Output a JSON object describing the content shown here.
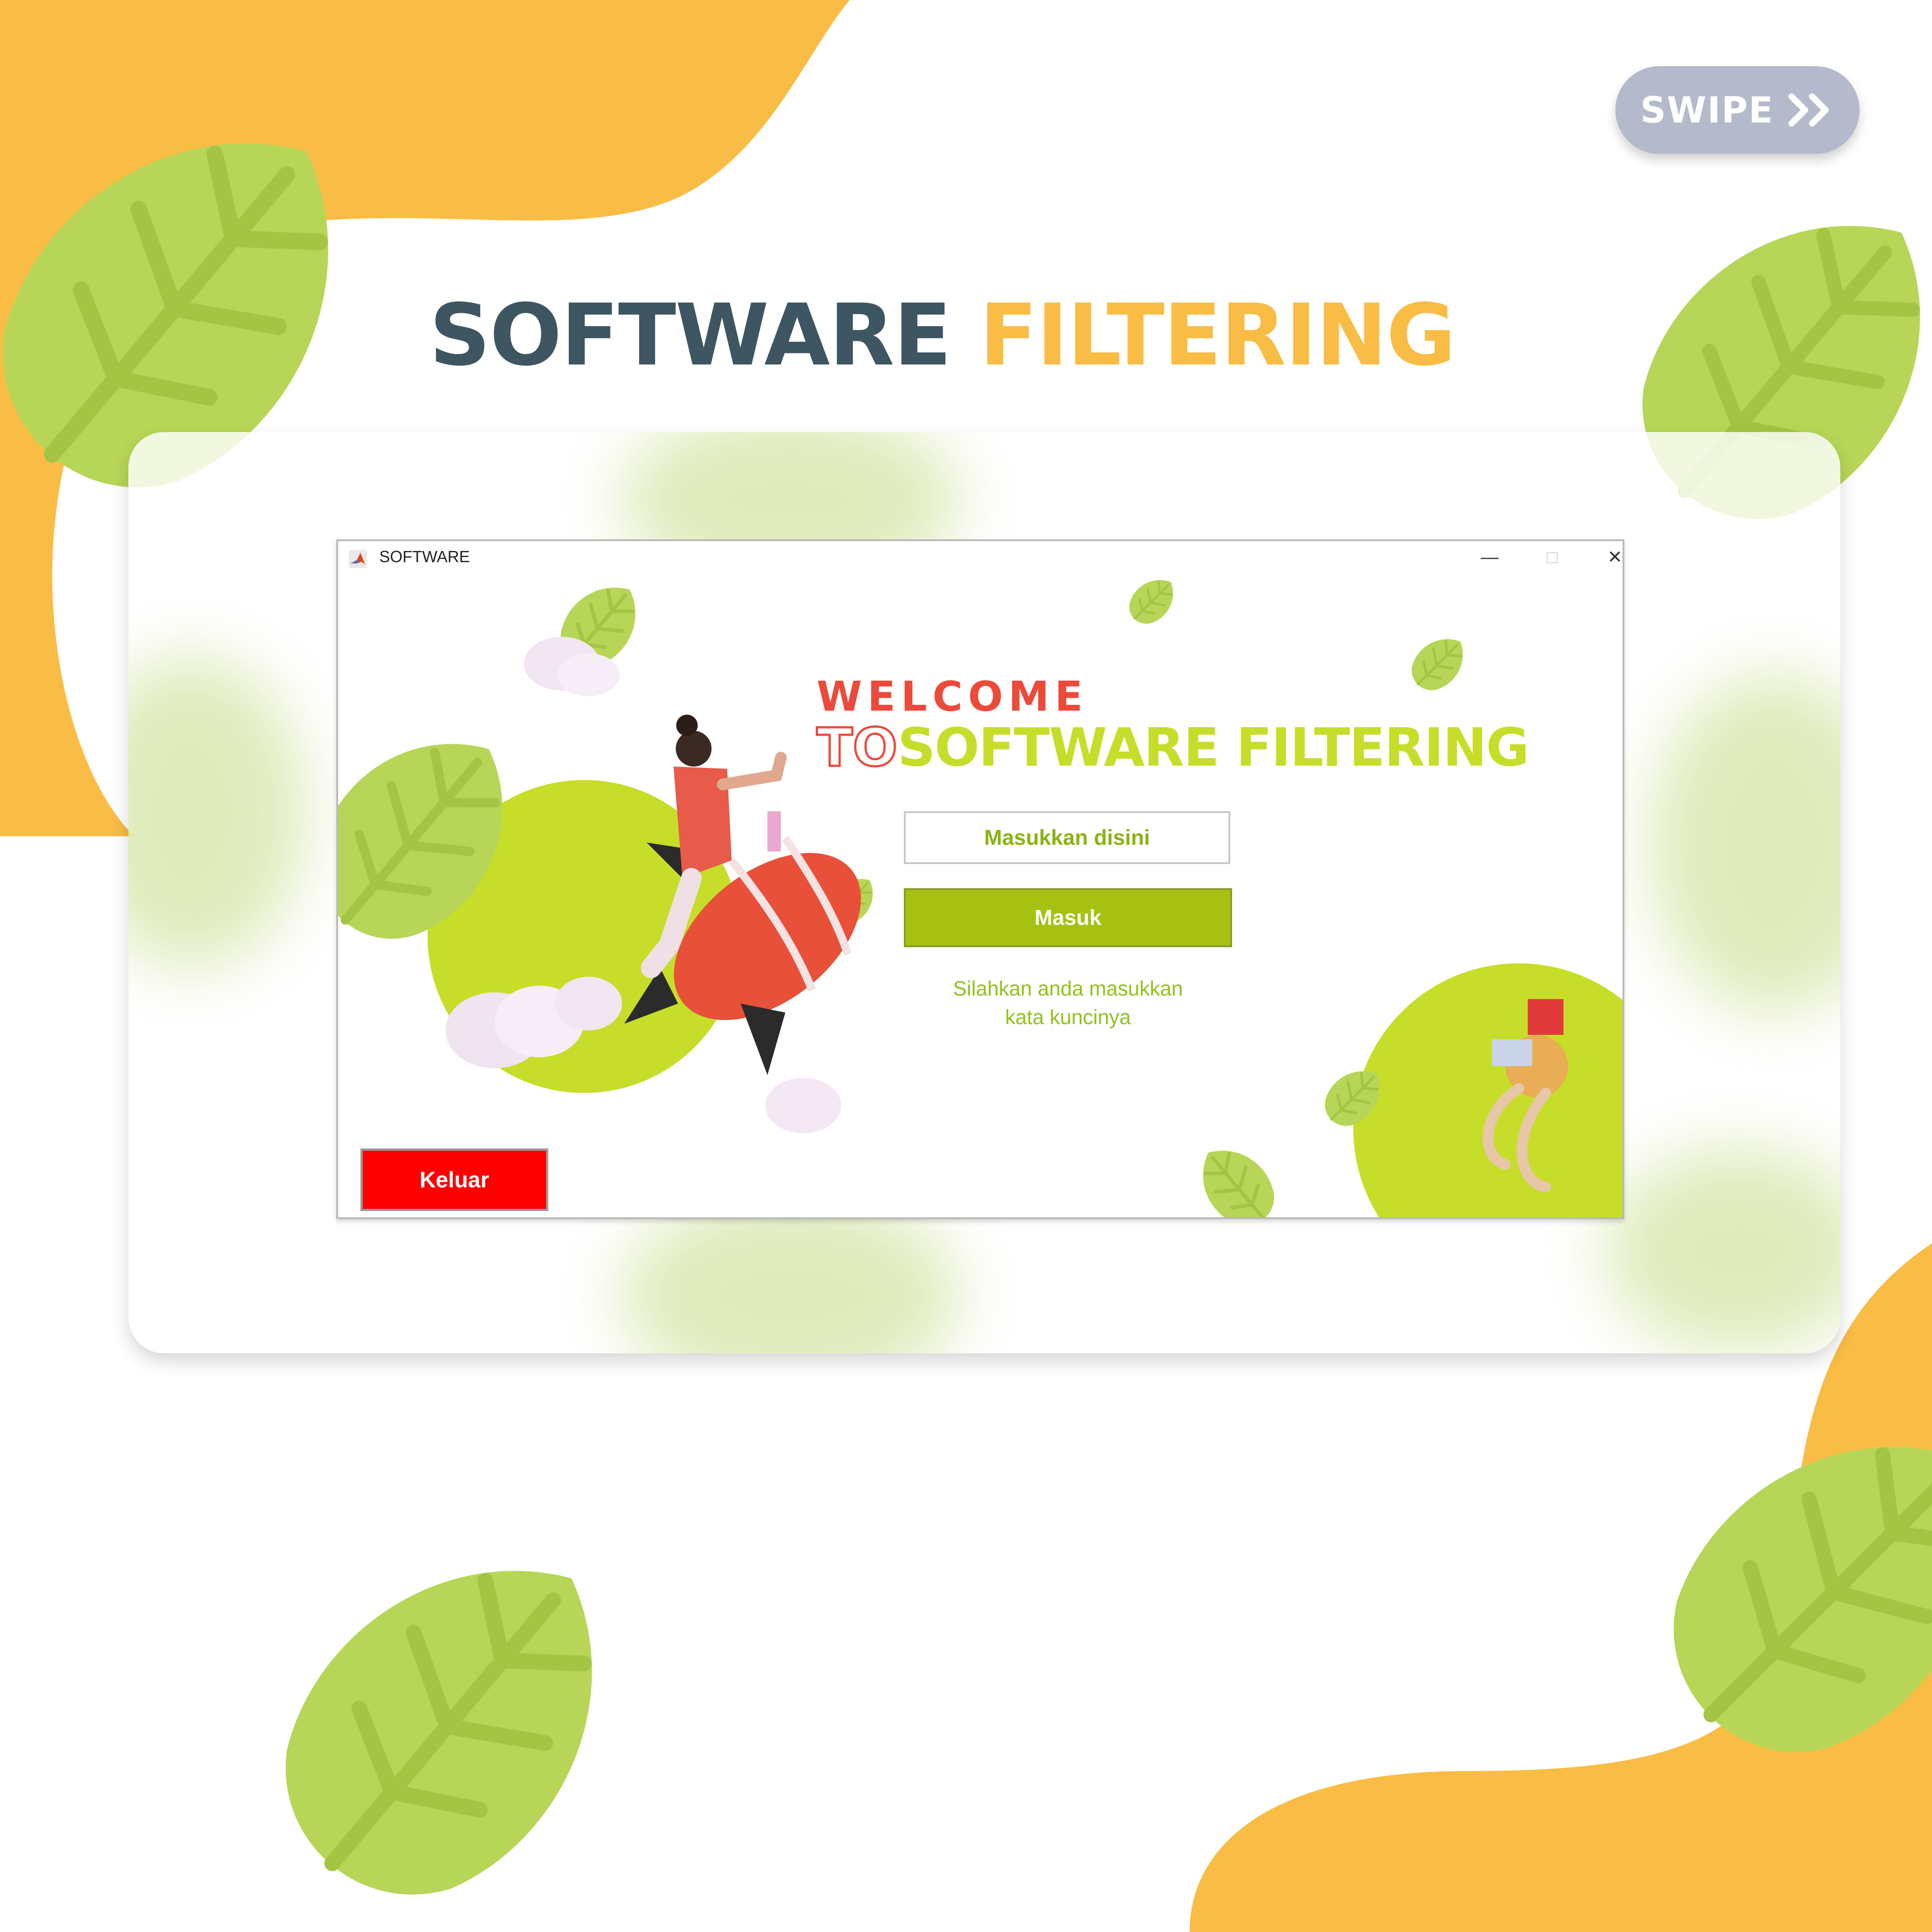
{
  "swipe": {
    "label": "SWIPE",
    "icon": "double-chevron-right-icon"
  },
  "heading": {
    "part1": "SOFTWARE",
    "part2": "FILTERING"
  },
  "window": {
    "title": "SOFTWARE",
    "app_icon": "matlab-icon",
    "controls": {
      "minimize": "—",
      "maximize": "□",
      "close": "✕"
    }
  },
  "app": {
    "welcome": "WELCOME",
    "to": "TO",
    "brand": "SOFTWARE FILTERING",
    "input_placeholder": "Masukkan disini",
    "submit_label": "Masuk",
    "hint_line1": "Silahkan anda masukkan",
    "hint_line2": "kata kuncinya",
    "exit_label": "Keluar"
  },
  "colors": {
    "orange": "#f9bd45",
    "leaf_green": "#b7d657",
    "heading_dark": "#3e5562",
    "lime": "#c6de29",
    "submit_green": "#a7c112",
    "exit_red": "#ff0000",
    "welcome_red": "#ec4a3a"
  }
}
